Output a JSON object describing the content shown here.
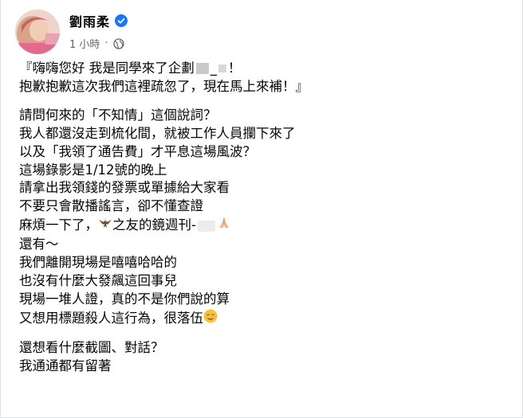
{
  "post": {
    "author": "劉雨柔",
    "time": "1 小時",
    "separator": "·",
    "lines": [
      "『嗨嗨您好 我是同學來了企劃",
      "！",
      "抱歉抱歉這次我們這裡疏忽了，現在馬上來補！』",
      "請問何來的「不知情」這個說詞？",
      "我人都還沒走到梳化間，就被工作人員攔下來了",
      "以及「我領了通告費」才平息這場風波？",
      "這場錄影是1/12號的晚上",
      "請拿出我領錢的發票或單據給大家看",
      "不要只會散播謠言，卻不懂查證",
      "麻煩一下了，",
      "之友的鏡週刊-",
      "還有～",
      "我們離開現場是嘻嘻哈哈的",
      "也沒有什麼大發飆這回事兒",
      "現場一堆人證，真的不是你們說的算",
      "又想用標題殺人這行為，很落伍",
      "還想看什麼截圖、對話？",
      "我通通都有留著"
    ],
    "underscore": "_",
    "icons": [
      "verified-badge-icon",
      "globe-icon",
      "eagle-emoji",
      "praying-hands-emoji",
      "relieved-face-emoji"
    ]
  }
}
